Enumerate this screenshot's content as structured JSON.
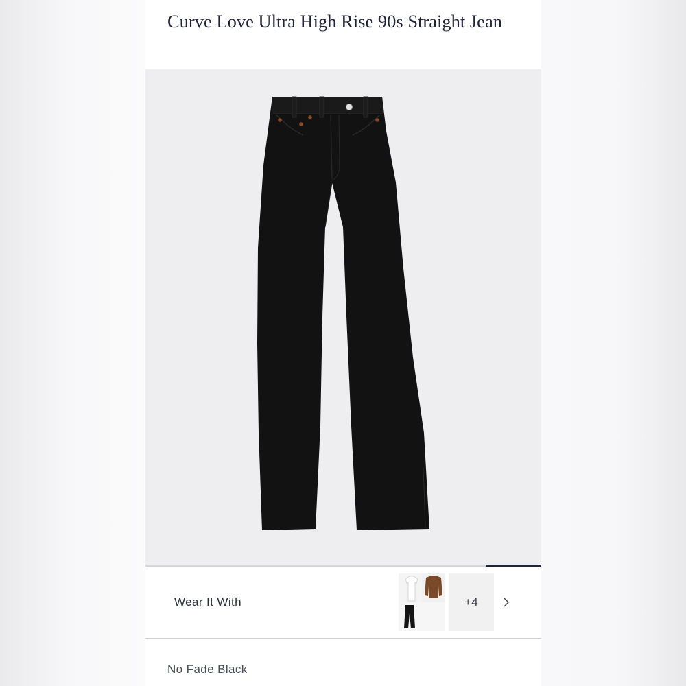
{
  "product": {
    "title": "Curve Love Ultra High Rise 90s Straight Jean",
    "image_icon": "black-jeans-product-image",
    "carousel_progress": 0.14
  },
  "wear_it_with": {
    "label": "Wear It With",
    "thumbnail_icon": "outfit-thumbnail",
    "more_count": "+4",
    "chevron_icon": "chevron-right-icon"
  },
  "color": {
    "name": "No Fade Black"
  },
  "colors": {
    "title_text": "#1f2438",
    "hero_background": "#eeedf0",
    "jean_black": "#121212",
    "progress_fill": "#1f2438"
  }
}
